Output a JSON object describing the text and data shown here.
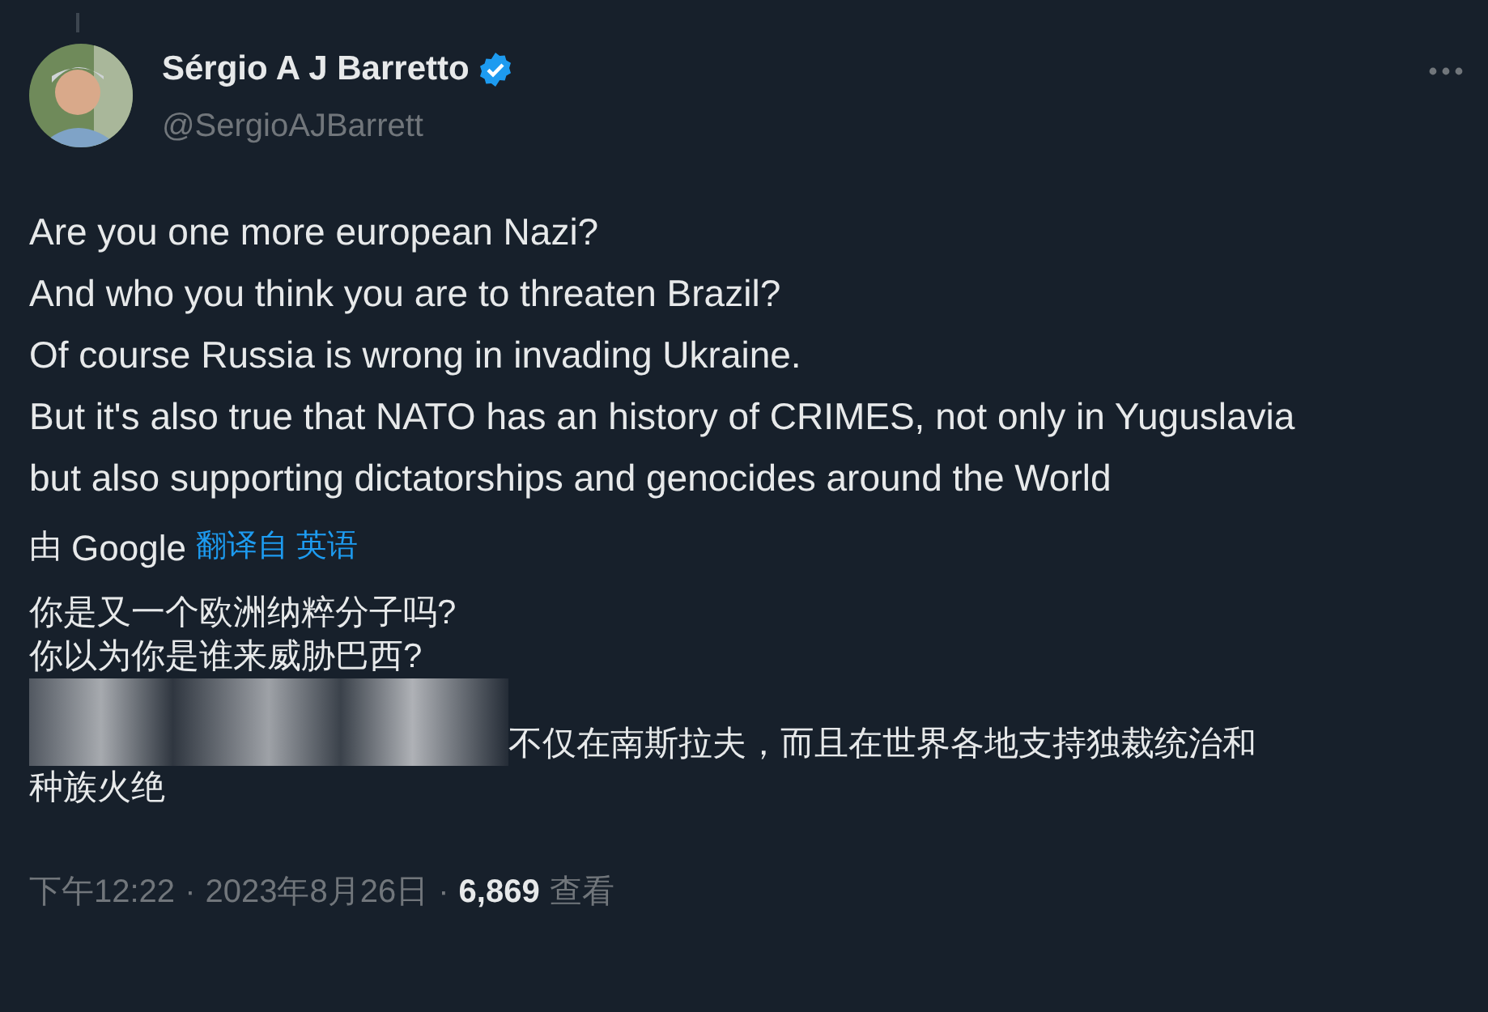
{
  "author": {
    "name": "Sérgio A J Barretto",
    "handle": "@SergioAJBarrett",
    "verified": true
  },
  "body": [
    "Are you one more european Nazi?",
    "And who you think you are to threaten Brazil?",
    "Of course Russia is wrong in invading Ukraine.",
    "But it's also true that NATO has an history of CRIMES, not only in Yuguslavia but also supporting dictatorships and genocides around the World"
  ],
  "translation": {
    "by": "由",
    "provider": "Google",
    "source": "翻译自 英语",
    "lines": [
      {
        "kind": "text",
        "text": "你是又一个欧洲纳粹分子吗?"
      },
      {
        "kind": "text",
        "text": "你以为你是谁来威胁巴西?"
      },
      {
        "kind": "blurred",
        "text": "不仅在南斯拉夫，而且在世界各地支持独裁统治和"
      },
      {
        "kind": "text",
        "text": "种族火绝"
      }
    ]
  },
  "footer": {
    "time": "下午12:22",
    "separator_1": "·",
    "date": "2023年8月26日",
    "separator_2": "·",
    "views": "6,869",
    "views_label": "查看"
  }
}
